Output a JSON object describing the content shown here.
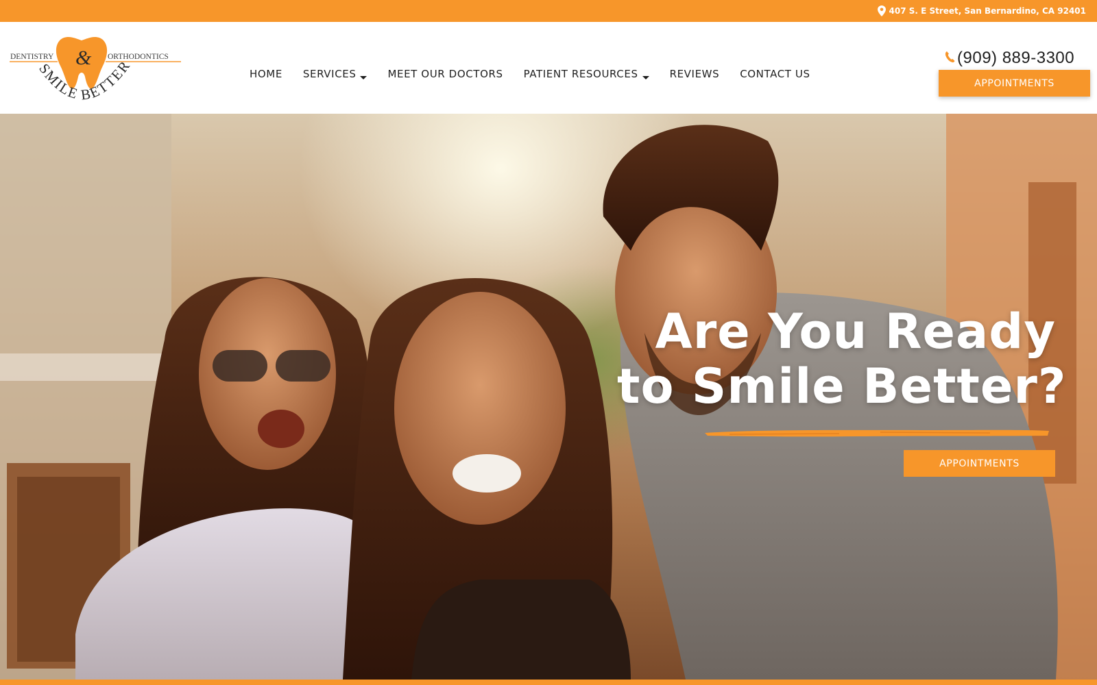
{
  "topbar": {
    "address": "407 S. E Street, San Bernardino, CA 92401",
    "icon": "map-pin-icon"
  },
  "logo": {
    "word_left": "DENTISTRY",
    "ampersand": "&",
    "word_right": "ORTHODONTICS",
    "tagline": "SMILE BETTER"
  },
  "nav": {
    "items": [
      {
        "label": "HOME",
        "has_dropdown": false
      },
      {
        "label": "SERVICES",
        "has_dropdown": true
      },
      {
        "label": "MEET OUR DOCTORS",
        "has_dropdown": false
      },
      {
        "label": "PATIENT RESOURCES",
        "has_dropdown": true
      },
      {
        "label": "REVIEWS",
        "has_dropdown": false
      },
      {
        "label": "CONTACT US",
        "has_dropdown": false
      }
    ]
  },
  "header": {
    "phone": "(909) 889-3300",
    "phone_icon": "phone-icon",
    "appointments_label": "APPOINTMENTS"
  },
  "hero": {
    "title_line1": "Are You Ready",
    "title_line2": "to Smile Better?",
    "appointments_label": "APPOINTMENTS"
  },
  "colors": {
    "accent": "#f7962a",
    "text_dark": "#1e1e1e",
    "white": "#ffffff"
  }
}
